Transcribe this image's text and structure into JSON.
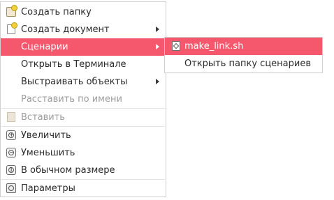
{
  "main_menu": {
    "items": [
      {
        "label": "Создать папку",
        "icon": "folder-new-icon"
      },
      {
        "label": "Создать документ",
        "icon": "document-new-icon",
        "submenu": true
      },
      {
        "label": "Сценарии",
        "submenu": true,
        "highlighted": true
      },
      {
        "label": "Открыть в Терминале"
      },
      {
        "label": "Выстраивать объекты",
        "submenu": true
      },
      {
        "label": "Расставить по имени",
        "disabled": true
      },
      {
        "label": "Вставить",
        "icon": "paste-icon",
        "disabled": true
      },
      {
        "label": "Увеличить",
        "icon": "zoom-in-icon"
      },
      {
        "label": "Уменьшить",
        "icon": "zoom-out-icon"
      },
      {
        "label": "В обычном размере",
        "icon": "zoom-original-icon"
      },
      {
        "label": "Параметры",
        "icon": "preferences-icon"
      }
    ]
  },
  "scripts_submenu": {
    "items": [
      {
        "label": "make_link.sh",
        "icon": "script-icon",
        "highlighted": true
      },
      {
        "label": "Открыть папку сценариев"
      }
    ]
  },
  "colors": {
    "highlight": "#f5576c",
    "disabled_text": "#9c9c9c"
  }
}
